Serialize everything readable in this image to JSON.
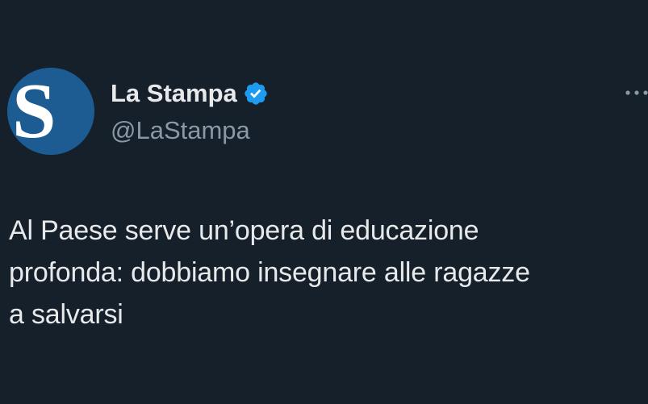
{
  "tweet": {
    "avatar_letter": "S",
    "display_name": "La Stampa",
    "handle": "@LaStampa",
    "verified_icon": "verified-badge-icon",
    "more_icon": "more-options-icon",
    "text": "Al Paese serve un’opera di educazione\nprofonda: dobbiamo insegnare alle ragazze\na salvarsi"
  },
  "colors": {
    "background": "#15202b",
    "primary_text": "#e7e9ea",
    "secondary_text": "#8b98a5",
    "verified_blue": "#1d9bf0",
    "avatar_blue": "#1d5c93"
  }
}
